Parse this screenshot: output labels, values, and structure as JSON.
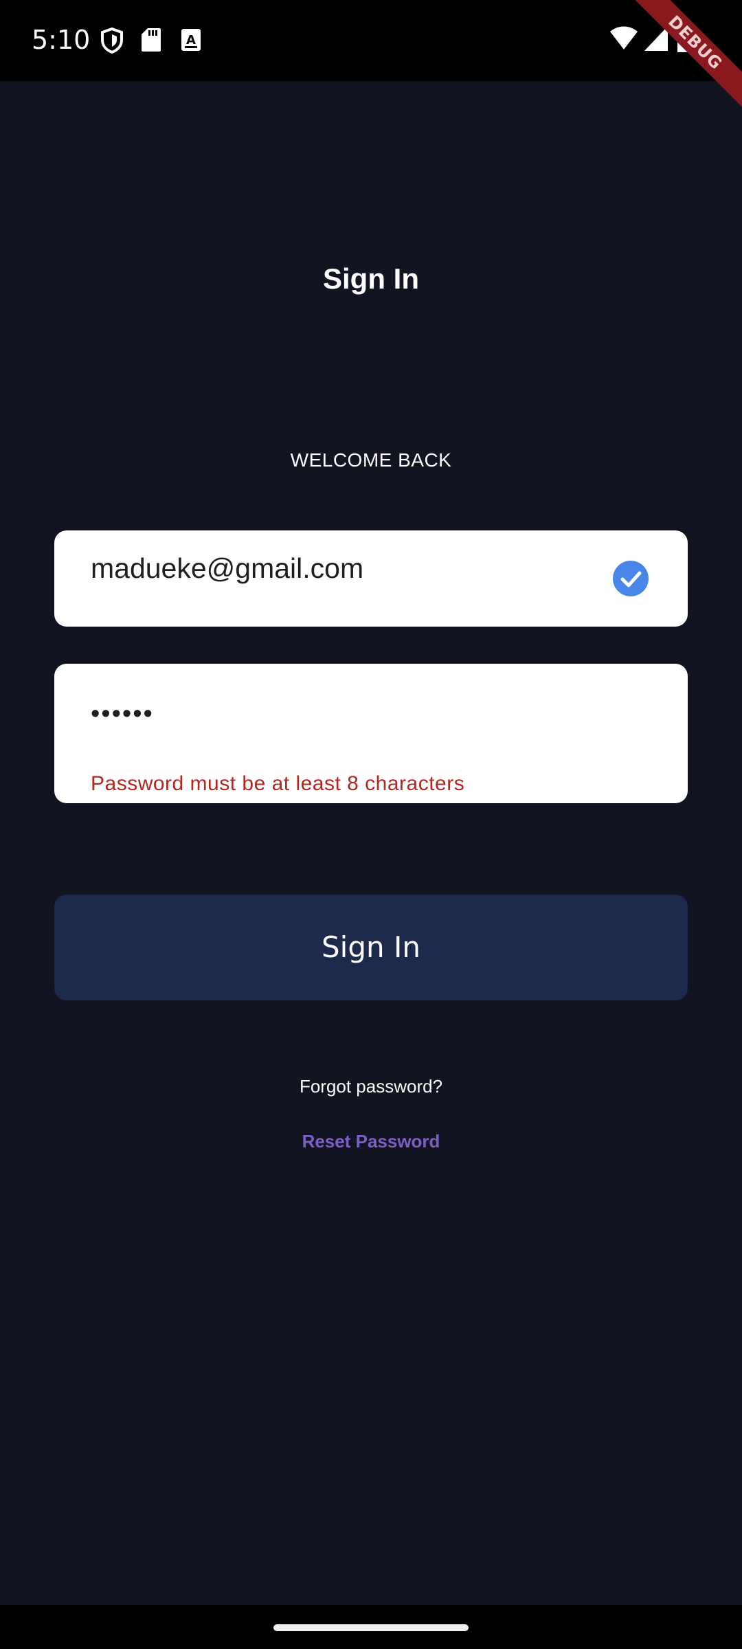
{
  "status_bar": {
    "time": "5:10",
    "icons": [
      "shield-icon",
      "sd-card-icon",
      "a-box-icon",
      "wifi-icon",
      "signal-icon",
      "battery-icon"
    ]
  },
  "debug_banner": "DEBUG",
  "page": {
    "title": "Sign In",
    "welcome": "WELCOME BACK"
  },
  "form": {
    "email_value": "madueke@gmail.com",
    "password_value": "••••••",
    "password_error": "Password must be at least 8 characters",
    "submit_label": "Sign In"
  },
  "footer": {
    "forgot_text": "Forgot password?",
    "reset_label": "Reset Password"
  },
  "colors": {
    "background": "#121421",
    "button": "#1e2a4b",
    "check": "#4a85ea",
    "error": "#b3261e",
    "link": "#7b5fc4"
  }
}
